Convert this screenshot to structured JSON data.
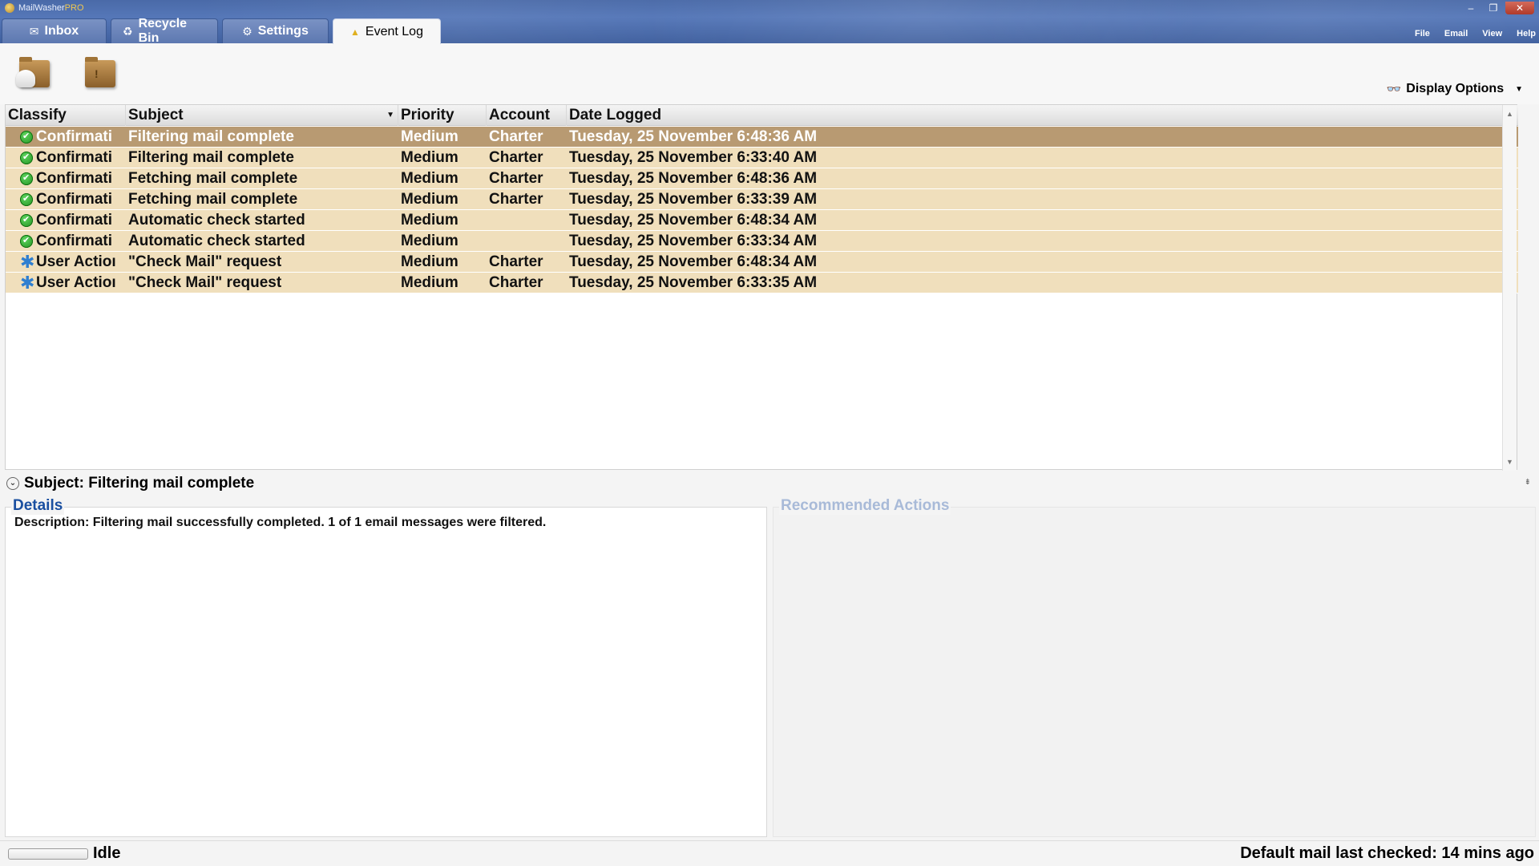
{
  "app": {
    "name": "MailWasher",
    "name_suffix": "PRO"
  },
  "window_controls": {
    "minimize": "–",
    "restore": "❐",
    "close": "✕"
  },
  "tabs": [
    {
      "label": "Inbox",
      "icon": "envelope-icon"
    },
    {
      "label": "Recycle Bin",
      "icon": "recycle-icon"
    },
    {
      "label": "Settings",
      "icon": "gear-icon"
    },
    {
      "label": "Event Log",
      "icon": "warning-icon",
      "active": true
    }
  ],
  "menu": [
    "File",
    "Email",
    "View",
    "Help"
  ],
  "toolbar": {
    "display_options_label": "Display Options"
  },
  "grid": {
    "columns": [
      "Classify",
      "Subject",
      "Priority",
      "Account",
      "Date Logged"
    ],
    "rows": [
      {
        "status": "check",
        "classify": "Confirmati",
        "subject": "Filtering mail complete",
        "priority": "Medium",
        "account": "Charter",
        "date": "Tuesday, 25 November 6:48:36 AM",
        "selected": true
      },
      {
        "status": "check",
        "classify": "Confirmati",
        "subject": "Filtering mail complete",
        "priority": "Medium",
        "account": "Charter",
        "date": "Tuesday, 25 November 6:33:40 AM"
      },
      {
        "status": "check",
        "classify": "Confirmati",
        "subject": "Fetching mail complete",
        "priority": "Medium",
        "account": "Charter",
        "date": "Tuesday, 25 November 6:48:36 AM"
      },
      {
        "status": "check",
        "classify": "Confirmati",
        "subject": "Fetching mail complete",
        "priority": "Medium",
        "account": "Charter",
        "date": "Tuesday, 25 November 6:33:39 AM"
      },
      {
        "status": "check",
        "classify": "Confirmati",
        "subject": "Automatic check started",
        "priority": "Medium",
        "account": "",
        "date": "Tuesday, 25 November 6:48:34 AM"
      },
      {
        "status": "check",
        "classify": "Confirmati",
        "subject": "Automatic check started",
        "priority": "Medium",
        "account": "",
        "date": "Tuesday, 25 November 6:33:34 AM"
      },
      {
        "status": "star",
        "classify": "User Actioı",
        "subject": "\"Check Mail\" request",
        "priority": "Medium",
        "account": "Charter",
        "date": "Tuesday, 25 November 6:48:34 AM"
      },
      {
        "status": "star",
        "classify": "User Actioı",
        "subject": "\"Check Mail\" request",
        "priority": "Medium",
        "account": "Charter",
        "date": "Tuesday, 25 November 6:33:35 AM"
      }
    ]
  },
  "detail": {
    "subject_line": "Subject: Filtering mail complete",
    "details_title": "Details",
    "description": "Description: Filtering mail successfully completed. 1 of 1 email messages were filtered.",
    "actions_title": "Recommended Actions"
  },
  "status": {
    "progress_fraction": 0,
    "state": "Idle",
    "last_checked": "Default mail last checked: 14 mins ago"
  },
  "colors": {
    "row_bg": "#f0dfbc",
    "row_selected": "#b89a72",
    "accent_link": "#1a4fa0"
  }
}
